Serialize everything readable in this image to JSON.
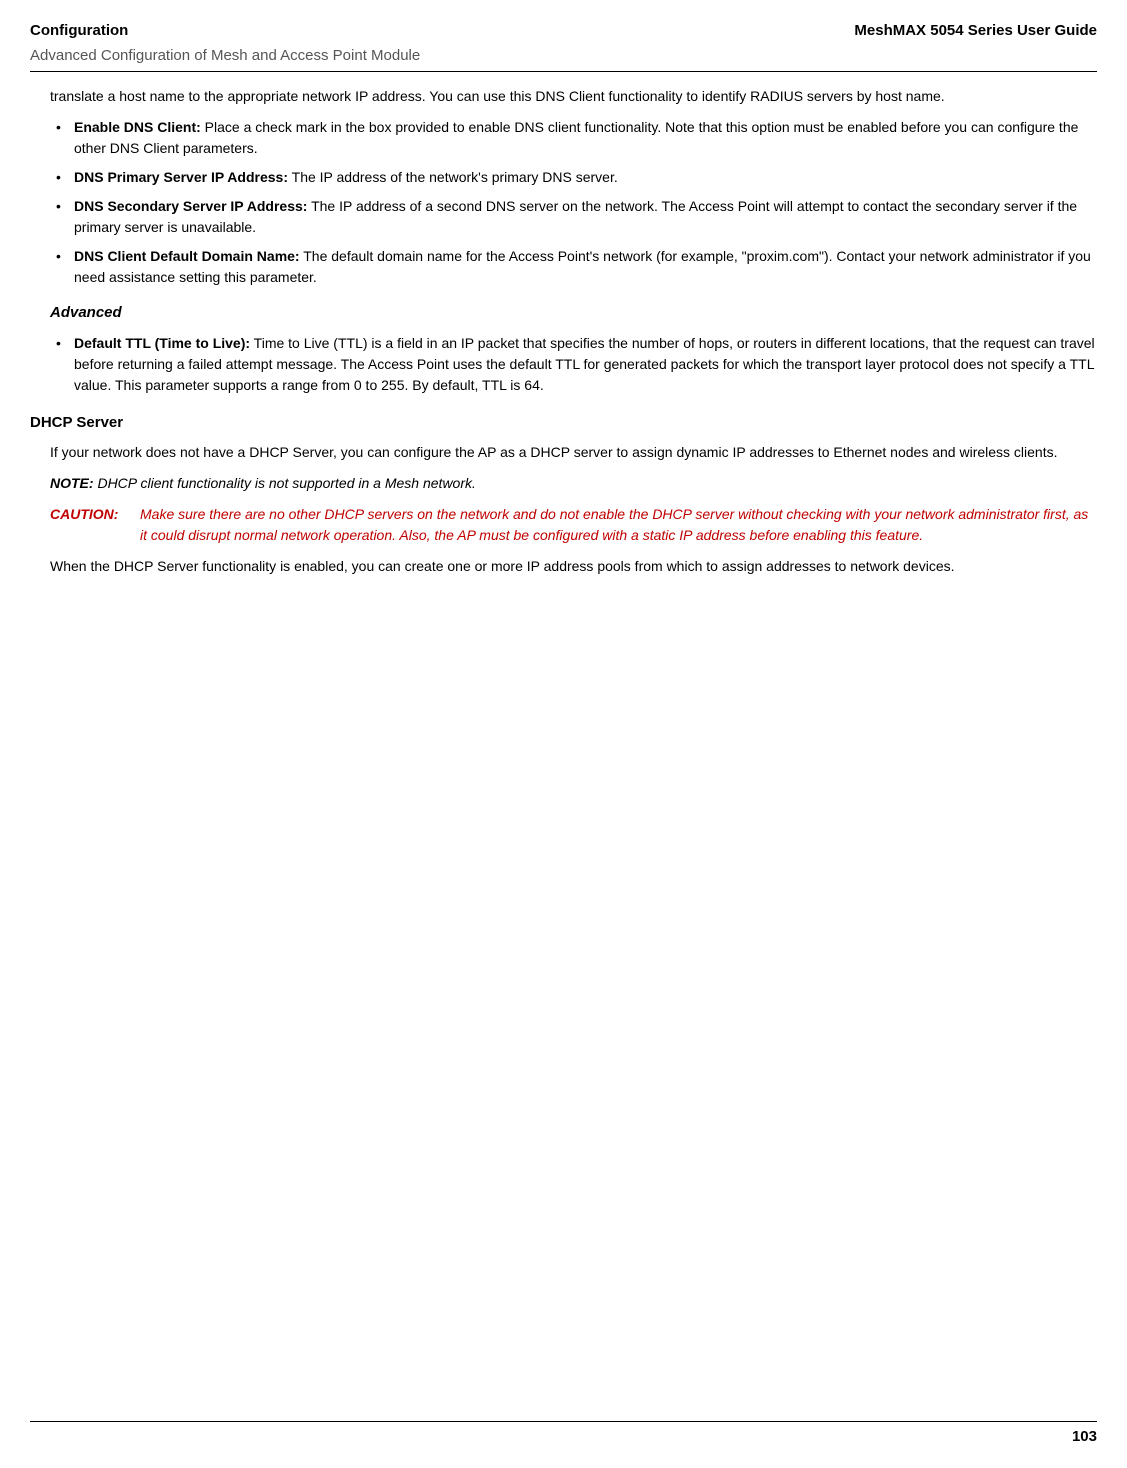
{
  "header": {
    "left": "Configuration",
    "right": "MeshMAX 5054 Series User Guide",
    "sub": "Advanced Configuration of Mesh and Access Point Module"
  },
  "intro_para": "translate a host name to the appropriate network IP address. You can use this DNS Client functionality to identify RADIUS servers by host name.",
  "dns_bullets": [
    {
      "bold": "Enable DNS Client:",
      "text": " Place a check mark in the box provided to enable DNS client functionality. Note that this option must be enabled before you can configure the other DNS Client parameters."
    },
    {
      "bold": "DNS Primary Server IP Address:",
      "text": " The IP address of the network's primary DNS server."
    },
    {
      "bold": "DNS Secondary Server IP Address:",
      "text": " The IP address of a second DNS server on the network. The Access Point will attempt to contact the secondary server if the primary server is unavailable."
    },
    {
      "bold": "DNS Client Default Domain Name:",
      "text": " The default domain name for the Access Point's network (for example, \"proxim.com\"). Contact your network administrator if you need assistance setting this parameter."
    }
  ],
  "advanced_heading": "Advanced",
  "advanced_bullets": [
    {
      "bold": "Default TTL (Time to Live):",
      "text": " Time to Live (TTL) is a field in an IP packet that specifies the number of hops, or routers in different locations, that the request can travel before returning a failed attempt message. The Access Point uses the default TTL for generated packets for which the transport layer protocol does not specify a TTL value. This parameter supports a range from 0 to 255. By default, TTL is 64."
    }
  ],
  "dhcp_heading": "DHCP Server",
  "dhcp_para1": "If your network does not have a DHCP Server, you can configure the AP as a DHCP server to assign dynamic IP addresses to Ethernet nodes and wireless clients.",
  "note": {
    "label": "NOTE:",
    "text": " DHCP client functionality is not supported in a Mesh network."
  },
  "caution": {
    "label": "CAUTION:",
    "text": "Make sure there are no other DHCP servers on the network and do not enable the DHCP server without checking with your network administrator first, as it could disrupt normal network operation. Also, the AP must be configured with a static IP address before enabling this feature."
  },
  "dhcp_para2": "When the DHCP Server functionality is enabled, you can create one or more IP address pools from which to assign addresses to network devices.",
  "page_number": "103"
}
